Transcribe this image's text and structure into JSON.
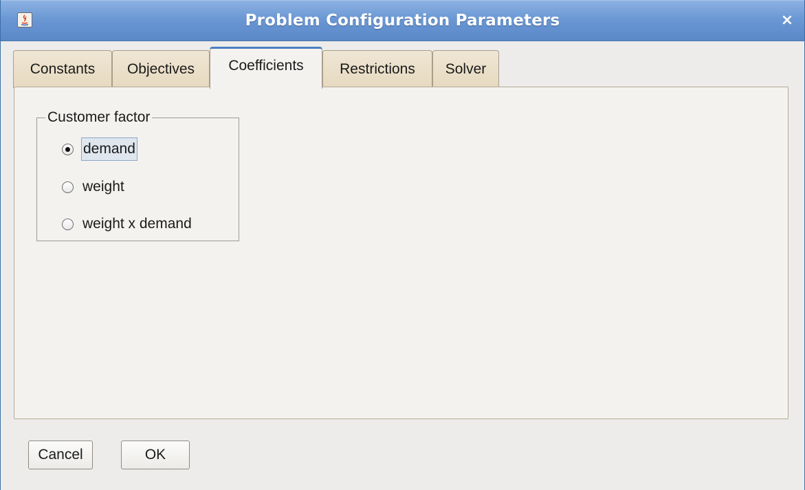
{
  "window": {
    "title": "Problem Configuration Parameters",
    "close_glyph": "×",
    "icon": "java-app-icon"
  },
  "tabs": [
    {
      "label": "Constants",
      "active": false
    },
    {
      "label": "Objectives",
      "active": false
    },
    {
      "label": "Coefficients",
      "active": true
    },
    {
      "label": "Restrictions",
      "active": false
    },
    {
      "label": "Solver",
      "active": false
    }
  ],
  "customer_factor": {
    "legend": "Customer factor",
    "options": [
      {
        "label": "demand",
        "selected": true
      },
      {
        "label": "weight",
        "selected": false
      },
      {
        "label": "weight x demand",
        "selected": false
      }
    ]
  },
  "buttons": {
    "cancel": "Cancel",
    "ok": "OK"
  },
  "colors": {
    "titlebar": "#6b98d4",
    "active_tab_accent": "#4a7fc1",
    "inactive_tab": "#e6d9bf"
  }
}
